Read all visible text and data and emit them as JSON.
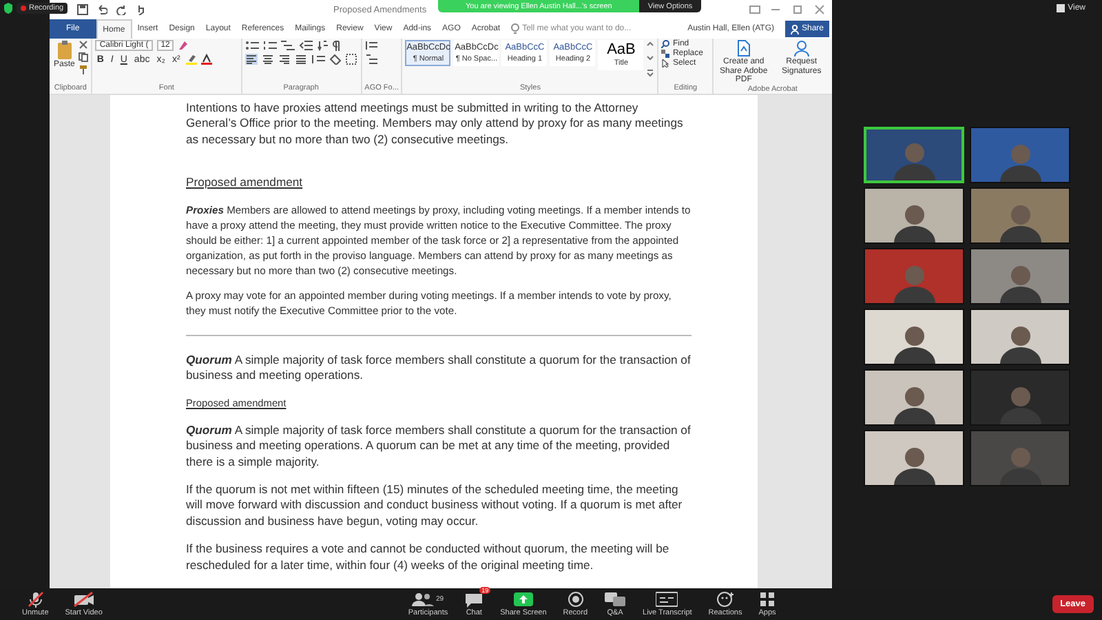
{
  "recording": {
    "label": "Recording"
  },
  "banner": {
    "text": "You are viewing Ellen Austin Hall...'s screen",
    "options": "View Options"
  },
  "view_button": {
    "label": "View"
  },
  "word": {
    "title": "Proposed Amendments",
    "tabs": [
      {
        "label": "File",
        "selected": false
      },
      {
        "label": "Home",
        "selected": true
      },
      {
        "label": "Insert",
        "selected": false
      },
      {
        "label": "Design",
        "selected": false
      },
      {
        "label": "Layout",
        "selected": false
      },
      {
        "label": "References",
        "selected": false
      },
      {
        "label": "Mailings",
        "selected": false
      },
      {
        "label": "Review",
        "selected": false
      },
      {
        "label": "View",
        "selected": false
      },
      {
        "label": "Add-ins",
        "selected": false
      },
      {
        "label": "AGO",
        "selected": false
      },
      {
        "label": "Acrobat",
        "selected": false
      }
    ],
    "tell_me": "Tell me what you want to do...",
    "user": "Austin Hall, Ellen (ATG)",
    "share": "Share",
    "ribbon": {
      "clipboard": {
        "label": "Clipboard",
        "paste": "Paste"
      },
      "font": {
        "label": "Font",
        "font_name": "Calibri Light (",
        "font_size": "12",
        "buttons": [
          "B",
          "I",
          "U",
          "abc",
          "x₂",
          "x²"
        ]
      },
      "paragraph": {
        "label": "Paragraph"
      },
      "ago": {
        "label": "AGO Fo..."
      },
      "styles": {
        "label": "Styles",
        "items": [
          {
            "preview": "AaBbCcDc",
            "name": "¶ Normal",
            "selected": true
          },
          {
            "preview": "AaBbCcDc",
            "name": "¶ No Spac...",
            "selected": false
          },
          {
            "preview": "AaBbCcC",
            "name": "Heading 1",
            "selected": false
          },
          {
            "preview": "AaBbCcC",
            "name": "Heading 2",
            "selected": false
          },
          {
            "preview": "AaB",
            "name": "Title",
            "selected": false
          }
        ]
      },
      "editing": {
        "label": "Editing",
        "items": [
          "Find",
          "Replace",
          "Select"
        ]
      },
      "acrobat": {
        "label": "Adobe Acrobat",
        "items": [
          "Create and Share Adobe PDF",
          "Request Signatures"
        ]
      }
    }
  },
  "document": {
    "blocks": [
      {
        "kind": "paragraph",
        "text": "Intentions to have proxies attend meetings must be submitted in writing to the Attorney General’s Office prior to the meeting. Members may only attend by proxy for as many meetings as necessary but no more than two (2) consecutive meetings."
      },
      {
        "kind": "heading",
        "text": "Proposed amendment"
      },
      {
        "kind": "small",
        "text": "**Proxies** Members are allowed to attend meetings by proxy, including voting meetings. If a member intends to have a proxy attend the meeting, they must provide written notice to the Executive Committee. The proxy should be either: 1] a current appointed member of the task force or 2] a representative from the appointed organization, as put forth in the proviso language. Members can attend by proxy for as many meetings as necessary but no more than two (2) consecutive meetings."
      },
      {
        "kind": "small",
        "text": "A proxy may vote for an appointed member during voting meetings. If a member intends to vote by proxy, they must notify the Executive Committee prior to the vote."
      },
      {
        "kind": "rule"
      },
      {
        "kind": "paragraph",
        "text": "**Quorum** A simple majority of task force members shall constitute a quorum for the transaction of business and meeting operations."
      },
      {
        "kind": "subheading",
        "text": "Proposed amendment"
      },
      {
        "kind": "paragraph",
        "text": "**Quorum** A simple majority of task force members shall constitute a quorum for the transaction of business and meeting operations. A quorum can be met at any time of the meeting, provided there is a simple majority."
      },
      {
        "kind": "paragraph",
        "text": "If the quorum is not met within fifteen (15) minutes of the scheduled meeting time, the meeting will move forward with discussion and conduct business without voting.  If a quorum is met after discussion and business have begun, voting may occur."
      },
      {
        "kind": "paragraph",
        "text": "If the business requires a vote and cannot be conducted without quorum, the meeting will be rescheduled for a later time, within four (4) weeks of the original meeting time."
      }
    ]
  },
  "videos": [
    {
      "speaking": true
    },
    {
      "speaking": false
    },
    {
      "speaking": false
    },
    {
      "speaking": false
    },
    {
      "speaking": false
    },
    {
      "speaking": false
    },
    {
      "speaking": false
    },
    {
      "speaking": false
    },
    {
      "speaking": false
    },
    {
      "speaking": false
    },
    {
      "speaking": false
    },
    {
      "speaking": false
    }
  ],
  "toolbar": {
    "left": [
      {
        "kind": "mic",
        "label": "Unmute"
      },
      {
        "kind": "video",
        "label": "Start Video"
      }
    ],
    "center": [
      {
        "kind": "participants",
        "label": "Participants",
        "count": "29"
      },
      {
        "kind": "chat",
        "label": "Chat",
        "badge": "19"
      },
      {
        "kind": "share",
        "label": "Share Screen"
      },
      {
        "kind": "record",
        "label": "Record"
      },
      {
        "kind": "qa",
        "label": "Q&A"
      },
      {
        "kind": "transcript",
        "label": "Live Transcript"
      },
      {
        "kind": "reactions",
        "label": "Reactions"
      },
      {
        "kind": "apps",
        "label": "Apps"
      }
    ],
    "leave": "Leave"
  }
}
